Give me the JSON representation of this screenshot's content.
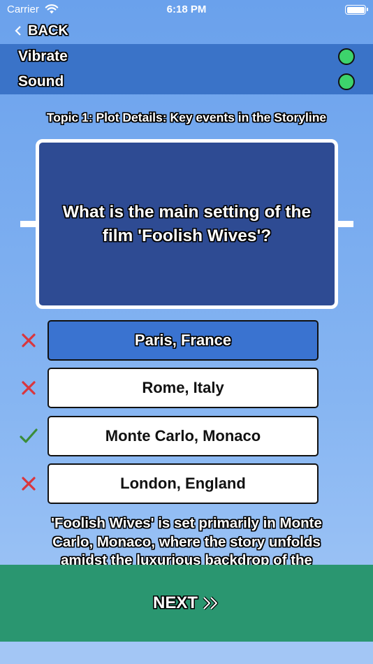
{
  "status_bar": {
    "carrier": "Carrier",
    "time": "6:18 PM"
  },
  "nav": {
    "back_label": "BACK"
  },
  "settings": [
    {
      "label": "Vibrate",
      "enabled": true
    },
    {
      "label": "Sound",
      "enabled": true
    }
  ],
  "topic": "Topic 1: Plot Details: Key events in the Storyline",
  "question": "What is the main setting of the film 'Foolish Wives'?",
  "answers": [
    {
      "label": "Paris, France",
      "mark": "cross",
      "selected": true
    },
    {
      "label": "Rome, Italy",
      "mark": "cross",
      "selected": false
    },
    {
      "label": "Monte Carlo, Monaco",
      "mark": "check",
      "selected": false
    },
    {
      "label": "London, England",
      "mark": "cross",
      "selected": false
    }
  ],
  "explanation": "'Foolish Wives' is set primarily in Monte Carlo, Monaco, where the story unfolds amidst the luxurious backdrop of the",
  "next_label": "NEXT",
  "colors": {
    "correct": "#3a8c3a",
    "wrong": "#d9363e",
    "toggle_on": "#3dd36c",
    "selected_answer": "#3a73d0",
    "next_bg": "#2a9670"
  }
}
